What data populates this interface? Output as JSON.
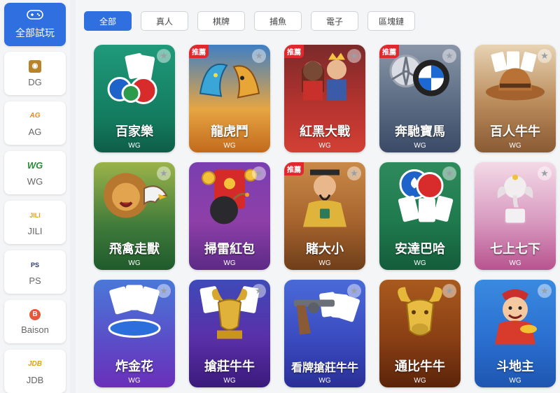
{
  "sidebar": {
    "items": [
      {
        "label": "全部試玩",
        "logo": ""
      },
      {
        "label": "DG",
        "logo": "DG"
      },
      {
        "label": "AG",
        "logo": "AG"
      },
      {
        "label": "WG",
        "logo": "WG"
      },
      {
        "label": "JILI",
        "logo": "JILI"
      },
      {
        "label": "PS",
        "logo": "PS"
      },
      {
        "label": "Baison",
        "logo": "B"
      },
      {
        "label": "JDB",
        "logo": "JDB"
      }
    ]
  },
  "tabs": [
    "全部",
    "真人",
    "棋牌",
    "捕魚",
    "電子",
    "區塊鏈"
  ],
  "badge_label": "推薦",
  "games": [
    {
      "title": "百家樂",
      "vendor": "WG",
      "hot": false
    },
    {
      "title": "龍虎鬥",
      "vendor": "WG",
      "hot": true
    },
    {
      "title": "紅黑大戰",
      "vendor": "WG",
      "hot": true
    },
    {
      "title": "奔馳寶馬",
      "vendor": "WG",
      "hot": true
    },
    {
      "title": "百人牛牛",
      "vendor": "WG",
      "hot": false
    },
    {
      "title": "飛禽走獸",
      "vendor": "WG",
      "hot": false
    },
    {
      "title": "掃雷紅包",
      "vendor": "WG",
      "hot": false
    },
    {
      "title": "賭大小",
      "vendor": "WG",
      "hot": true
    },
    {
      "title": "安達巴哈",
      "vendor": "WG",
      "hot": false
    },
    {
      "title": "七上七下",
      "vendor": "WG",
      "hot": false
    },
    {
      "title": "炸金花",
      "vendor": "WG",
      "hot": false
    },
    {
      "title": "搶莊牛牛",
      "vendor": "WG",
      "hot": false
    },
    {
      "title": "看牌搶莊牛牛",
      "vendor": "WG",
      "hot": false
    },
    {
      "title": "通比牛牛",
      "vendor": "WG",
      "hot": false
    },
    {
      "title": "斗地主",
      "vendor": "WG",
      "hot": false
    }
  ],
  "colors": {
    "accent": "#2f6fe0",
    "badge": "#e0282e"
  }
}
